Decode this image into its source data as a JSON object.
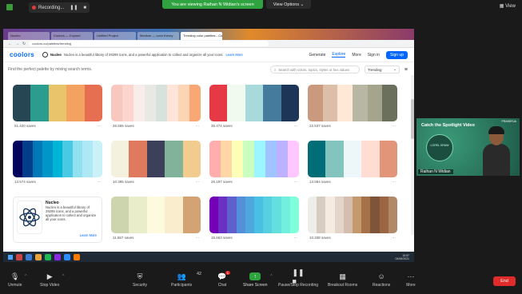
{
  "zoom": {
    "recording_label": "Recording...",
    "viewing_banner": "You are viewing Raihan N Widian's screen",
    "view_options": "View Options",
    "view_label": "View"
  },
  "browser": {
    "tabs": [
      "Nucleo",
      "Coolors — Explore",
      "Untitled Project",
      "Medium — color theory",
      "Trending color palettes - Coolors"
    ],
    "url": "coolors.co/palettes/trending"
  },
  "coolors": {
    "logo": "coolors",
    "nucleo_name": "Nucleo",
    "nucleo_text": "Nucleo is a beautiful library of 29299 icons, and a powerful application to collect and organize all your icons.",
    "learn_more": "Learn More",
    "nav": [
      "Generate",
      "Explore",
      "More",
      "Sign in",
      "Sign up"
    ],
    "search_hint": "Find the perfect palette by mixing search terms.",
    "search_placeholder": "Search with colors, topics, styles or hex values",
    "sort": "Trending",
    "palettes": [
      {
        "colors": [
          "#264653",
          "#2a9d8f",
          "#e9c46a",
          "#f4a261",
          "#e76f51"
        ],
        "saves": "51.420 saves"
      },
      {
        "colors": [
          "#f8c8c0",
          "#fcd5ce",
          "#f8edeb",
          "#e8e8e4",
          "#d8e2dc",
          "#ffe5d9",
          "#fcd5b5",
          "#f9a875"
        ],
        "saves": "26.665 saves"
      },
      {
        "colors": [
          "#e63946",
          "#f1faee",
          "#a8dadc",
          "#457b9d",
          "#1d3557"
        ],
        "saves": "35.474 saves"
      },
      {
        "colors": [
          "#cb997e",
          "#ddbea9",
          "#ffe8d6",
          "#b7b7a4",
          "#a5a58d",
          "#6b705c"
        ],
        "saves": "22.537 saves"
      },
      {
        "colors": [
          "#03045e",
          "#023e8a",
          "#0077b6",
          "#0096c7",
          "#00b4d8",
          "#48cae4",
          "#90e0ef",
          "#ade8f4",
          "#caf0f8"
        ],
        "saves": "13.574 saves"
      },
      {
        "colors": [
          "#f4f1de",
          "#e07a5f",
          "#3d405b",
          "#81b29a",
          "#f2cc8f"
        ],
        "saves": "10.395 saves"
      },
      {
        "colors": [
          "#ffadad",
          "#ffd6a5",
          "#fdffb6",
          "#caffbf",
          "#9bf6ff",
          "#a0c4ff",
          "#bdb2ff",
          "#ffc6ff"
        ],
        "saves": "26.197 saves"
      },
      {
        "colors": [
          "#006d77",
          "#83c5be",
          "#edf6f9",
          "#ffddd2",
          "#e29578"
        ],
        "saves": "13.584 saves"
      },
      {
        "colors": [
          "#ccd5ae",
          "#e9edc9",
          "#fefae0",
          "#faedcd",
          "#d4a373"
        ],
        "saves": "11.567 saves"
      },
      {
        "colors": [
          "#7400b8",
          "#6930c3",
          "#5e60ce",
          "#5390d9",
          "#4ea8de",
          "#48bfe3",
          "#56cfe1",
          "#64dfdf",
          "#72efdd",
          "#80ffdb"
        ],
        "saves": "15.663 saves"
      },
      {
        "colors": [
          "#edede9",
          "#d6ccc2",
          "#f5ebe0",
          "#e3d5ca",
          "#d5bdaf",
          "#c49a6c",
          "#a47148",
          "#7f5539",
          "#9c6644",
          "#b08968"
        ],
        "saves": "10.338 saves"
      }
    ]
  },
  "taskbar": {
    "time": "15:57",
    "date": "04/06/2021"
  },
  "video": {
    "title": "Catch the Spotlight Video",
    "circle_text": "LOREL DRAW",
    "brand": "PRAKERJA",
    "participant_name": "Raihan N Widian"
  },
  "toolbar": {
    "mute": "Unmute",
    "stop_video": "Stop Video",
    "security": "Security",
    "participants": "Participants",
    "participants_count": "42",
    "chat": "Chat",
    "chat_badge": "1",
    "share_screen": "Share Screen",
    "recording": "Pause/Stop Recording",
    "breakout": "Breakout Rooms",
    "reactions": "Reactions",
    "more": "More",
    "end": "End"
  },
  "colors": {
    "zoom_green": "#2fa33f",
    "end_red": "#e02b2b",
    "coolors_blue": "#0066ff"
  }
}
